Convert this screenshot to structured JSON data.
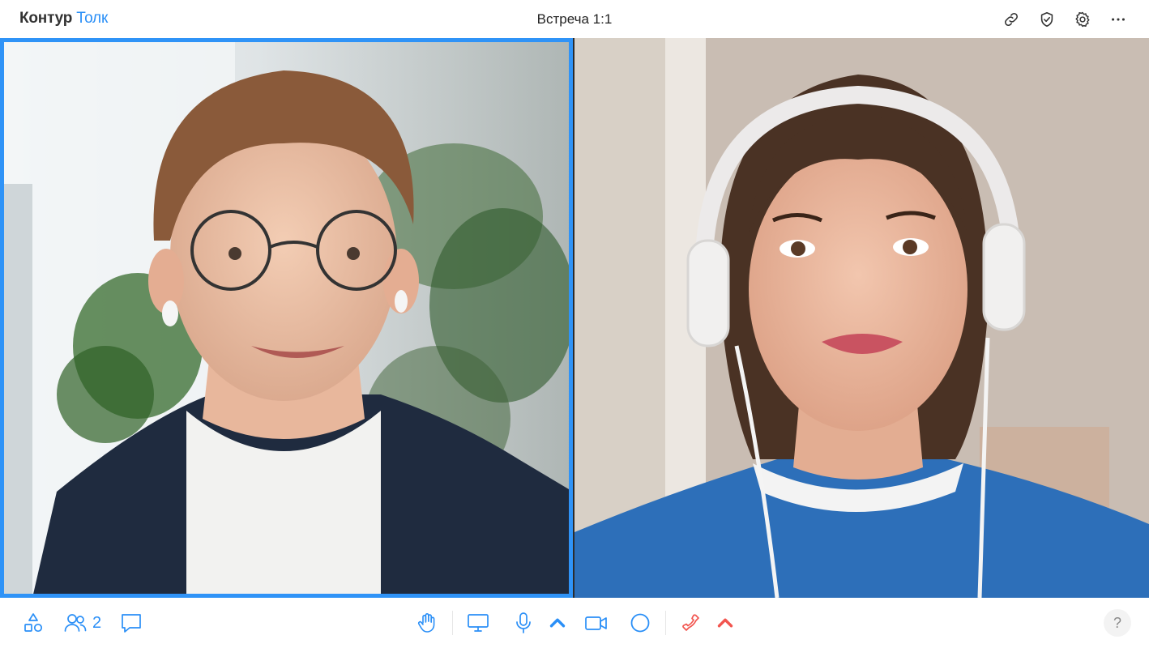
{
  "app": {
    "brand": "Контур",
    "product": "Толк",
    "meeting_title": "Встреча 1:1"
  },
  "header": {
    "actions": [
      {
        "icon": "link-icon"
      },
      {
        "icon": "shield-check-icon"
      },
      {
        "icon": "gear-icon"
      },
      {
        "icon": "more-dots-icon"
      }
    ]
  },
  "participants": {
    "count": "2",
    "tiles": [
      {
        "id": "participant-1",
        "speaking": true
      },
      {
        "id": "participant-2",
        "speaking": false
      }
    ]
  },
  "toolbar": {
    "left": [
      {
        "icon": "apps-icon"
      },
      {
        "icon": "participants-icon"
      },
      {
        "icon": "chat-icon"
      }
    ],
    "center": [
      {
        "icon": "raise-hand-icon"
      },
      {
        "icon": "screen-share-icon"
      },
      {
        "icon": "microphone-icon"
      },
      {
        "icon": "camera-icon"
      },
      {
        "icon": "record-icon"
      },
      {
        "icon": "hang-up-icon"
      }
    ],
    "help_label": "?"
  },
  "colors": {
    "accent": "#2a8ff7",
    "speaking_frame": "#2f93f7",
    "hangup": "#f2554f"
  }
}
